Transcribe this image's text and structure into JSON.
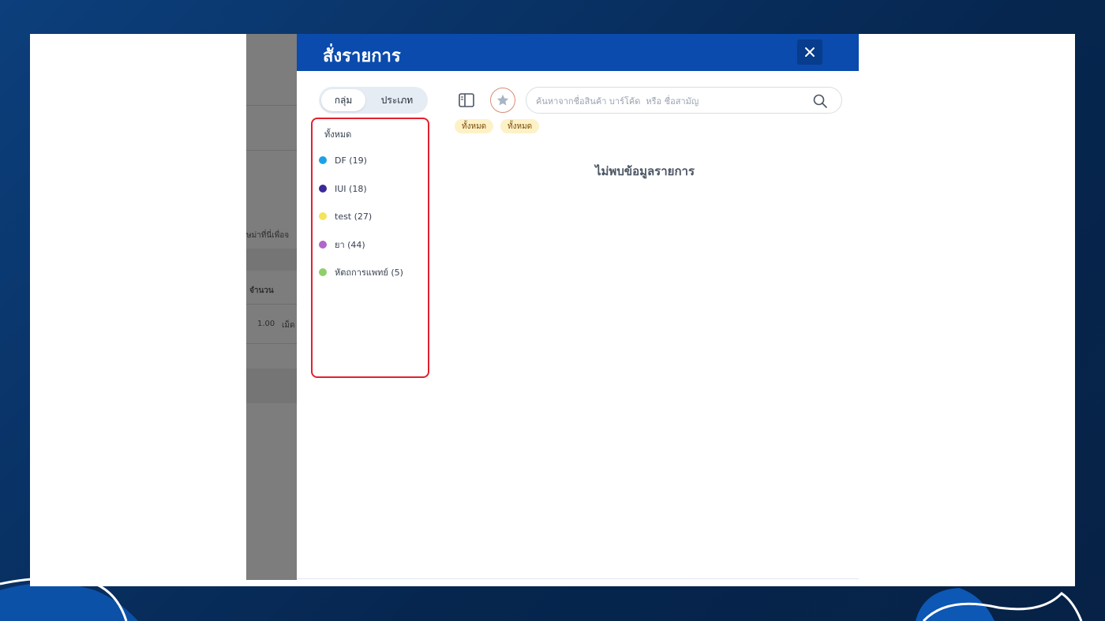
{
  "modal": {
    "title": "สั่งรายการ",
    "close_label": "✕"
  },
  "toggle": {
    "options": [
      "กลุ่ม",
      "ประเภท"
    ],
    "selected": "กลุ่ม"
  },
  "categories": {
    "all_label": "ทั้งหมด",
    "items": [
      {
        "label": "DF (19)",
        "color": "#1ea0e8"
      },
      {
        "label": "IUI (18)",
        "color": "#3a2a9a"
      },
      {
        "label": "test (27)",
        "color": "#f5e45a"
      },
      {
        "label": "ยา (44)",
        "color": "#b266c9"
      },
      {
        "label": "หัตถการแพทย์ (5)",
        "color": "#8fcf6a"
      }
    ]
  },
  "search": {
    "placeholder": "ค้นหาจากชื่อสินค้า บาร์โค้ด  หรือ ชื่อสามัญ",
    "value": ""
  },
  "filters": [
    "ทั้งหมด",
    "ทั้งหมด"
  ],
  "empty_message": "ไม่พบข้อมูลรายการ",
  "background_page": {
    "truncated_hint": "ษม่าที่นี่เพื่อจ",
    "column_header": "จำนวน",
    "row_quantity": "1.00",
    "row_unit": "เม็ด"
  },
  "colors": {
    "header": "#0a4bad",
    "highlight_border": "#e3202d",
    "chip_bg": "#fdf1c7"
  }
}
